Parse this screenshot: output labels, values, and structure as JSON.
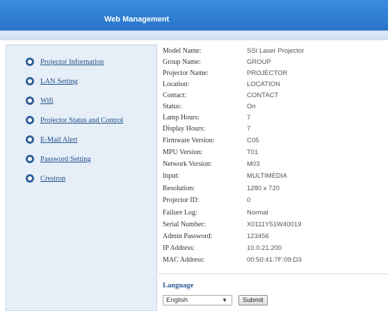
{
  "header": {
    "title": "Web Management"
  },
  "sidebar": {
    "items": [
      {
        "label": "Projector Information"
      },
      {
        "label": "LAN Setting"
      },
      {
        "label": "Wifi"
      },
      {
        "label": "Projector Status and Control"
      },
      {
        "label": "E-Mail Alert"
      },
      {
        "label": "Password Setting"
      },
      {
        "label": "Crestron"
      }
    ]
  },
  "info": {
    "rows": [
      {
        "label": "Model Name:",
        "value": "SSI Laser Projector"
      },
      {
        "label": "Group Name:",
        "value": "GROUP"
      },
      {
        "label": "Projector Name:",
        "value": "PROJECTOR"
      },
      {
        "label": "Location:",
        "value": "LOCATION"
      },
      {
        "label": "Contact:",
        "value": "CONTACT"
      },
      {
        "label": "Status:",
        "value": "On"
      },
      {
        "label": "Lamp Hours:",
        "value": "7"
      },
      {
        "label": "Display Hours:",
        "value": "7"
      },
      {
        "label": "Firmware Version:",
        "value": "C05"
      },
      {
        "label": "MPU Version:",
        "value": "T01"
      },
      {
        "label": "Network Version:",
        "value": "M03"
      },
      {
        "label": "Input:",
        "value": "MULTIMEDIA"
      },
      {
        "label": "Resolution:",
        "value": "1280 x 720"
      },
      {
        "label": "Projector ID:",
        "value": "0"
      },
      {
        "label": "Failure Log:",
        "value": "Normal"
      },
      {
        "label": "Serial Number:",
        "value": "X0111Y51W40019"
      },
      {
        "label": "Admin Password:",
        "value": "123456"
      },
      {
        "label": "IP Address:",
        "value": "10.0.21.200"
      },
      {
        "label": "MAC Address:",
        "value": "00:50:41:7F:09:D3"
      }
    ]
  },
  "language": {
    "title": "Language",
    "selected": "English",
    "submit_label": "Submit"
  },
  "icons": {
    "nav": "radio-bullet-icon",
    "dropdown": "chevron-down-icon"
  },
  "colors": {
    "header": "#2f7fd6",
    "sidebar": "#e6eef8",
    "link": "#1e4f86"
  }
}
